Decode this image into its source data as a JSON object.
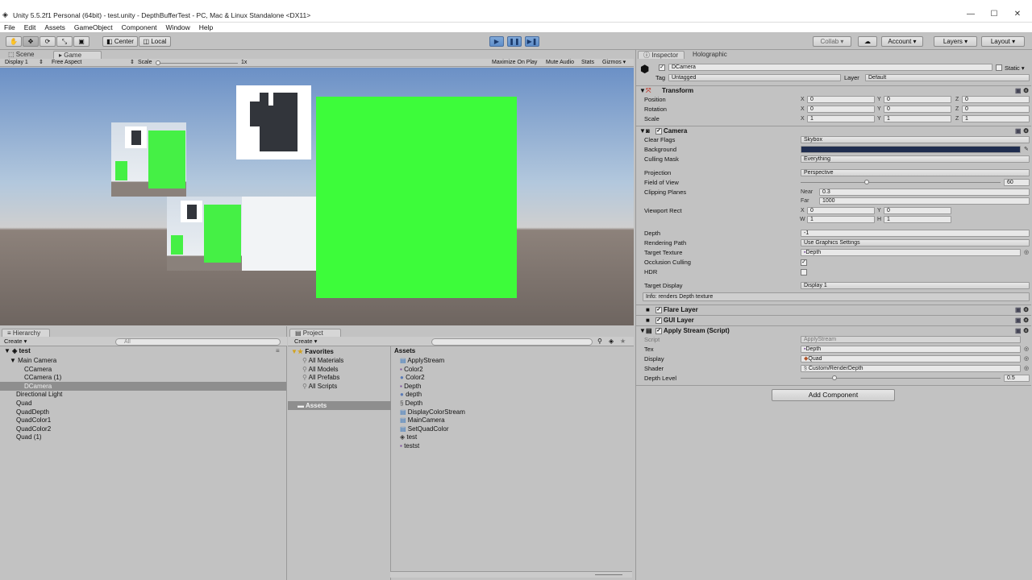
{
  "window": {
    "title": "Unity 5.5.2f1 Personal (64bit) - test.unity - DepthBufferTest - PC, Mac & Linux Standalone <DX11>",
    "controls": [
      "—",
      "☐",
      "✕"
    ]
  },
  "menu": [
    "File",
    "Edit",
    "Assets",
    "GameObject",
    "Component",
    "Window",
    "Help"
  ],
  "toolbar": {
    "pivot_label": "Center",
    "space_label": "Local",
    "collab_label": "Collab ▾",
    "account_label": "Account ▾",
    "layers_label": "Layers ▾",
    "layout_label": "Layout ▾"
  },
  "scene_tabs": [
    "Scene",
    "Game"
  ],
  "gamebar": {
    "display": "Display 1",
    "aspect": "Free Aspect",
    "scale_label": "Scale",
    "scale_value": "1x",
    "maximize": "Maximize On Play",
    "mute": "Mute Audio",
    "stats": "Stats",
    "gizmos": "Gizmos ▾"
  },
  "hierarchy": {
    "tab": "Hierarchy",
    "create": "Create ▾",
    "search_placeholder": "All",
    "scene": "test",
    "items": [
      {
        "label": "Main Camera",
        "indent": 1
      },
      {
        "label": "CCamera",
        "indent": 2
      },
      {
        "label": "CCamera (1)",
        "indent": 2
      },
      {
        "label": "DCamera",
        "indent": 2,
        "selected": true
      },
      {
        "label": "Directional Light",
        "indent": 1
      },
      {
        "label": "Quad",
        "indent": 1
      },
      {
        "label": "QuadDepth",
        "indent": 1
      },
      {
        "label": "QuadColor1",
        "indent": 1
      },
      {
        "label": "QuadColor2",
        "indent": 1
      },
      {
        "label": "Quad (1)",
        "indent": 1
      }
    ]
  },
  "project": {
    "tab": "Project",
    "create": "Create ▾",
    "favorites_label": "Favorites",
    "favorites": [
      "All Materials",
      "All Models",
      "All Prefabs",
      "All Scripts"
    ],
    "assets_folder": "Assets",
    "assets_header": "Assets",
    "assets": [
      {
        "label": "ApplyStream",
        "icon": "script-icon"
      },
      {
        "label": "Color2",
        "icon": "render-texture-icon"
      },
      {
        "label": "Color2",
        "icon": "material-icon"
      },
      {
        "label": "Depth",
        "icon": "render-texture-icon"
      },
      {
        "label": "depth",
        "icon": "material-icon"
      },
      {
        "label": "Depth",
        "icon": "shader-icon"
      },
      {
        "label": "DisplayColorStream",
        "icon": "script-icon"
      },
      {
        "label": "MainCamera",
        "icon": "script-icon"
      },
      {
        "label": "SetQuadColor",
        "icon": "script-icon"
      },
      {
        "label": "test",
        "icon": "scene-icon"
      },
      {
        "label": "testst",
        "icon": "render-texture-icon"
      }
    ]
  },
  "inspector": {
    "tabs": [
      "Inspector",
      "Holographic"
    ],
    "object_name": "DCamera",
    "static_label": "Static ▾",
    "tag_label": "Tag",
    "tag_value": "Untagged",
    "layer_label": "Layer",
    "layer_value": "Default",
    "transform": {
      "title": "Transform",
      "position_label": "Position",
      "rotation_label": "Rotation",
      "scale_label": "Scale",
      "position": [
        "0",
        "0",
        "0"
      ],
      "rotation": [
        "0",
        "0",
        "0"
      ],
      "scale": [
        "1",
        "1",
        "1"
      ]
    },
    "camera": {
      "title": "Camera",
      "clear_flags_label": "Clear Flags",
      "clear_flags": "Skybox",
      "background_label": "Background",
      "background_color": "#1f2d4f",
      "culling_mask_label": "Culling Mask",
      "culling_mask": "Everything",
      "projection_label": "Projection",
      "projection": "Perspective",
      "fov_label": "Field of View",
      "fov": "60",
      "fov_fraction": 0.33,
      "clipping_label": "Clipping Planes",
      "near_label": "Near",
      "near": "0.3",
      "far_label": "Far",
      "far": "1000",
      "viewport_label": "Viewport Rect",
      "viewport": [
        "0",
        "0",
        "1",
        "1"
      ],
      "depth_label": "Depth",
      "depth": "-1",
      "rendering_path_label": "Rendering Path",
      "rendering_path": "Use Graphics Settings",
      "target_texture_label": "Target Texture",
      "target_texture": "Depth",
      "occlusion_label": "Occlusion Culling",
      "hdr_label": "HDR",
      "target_display_label": "Target Display",
      "target_display": "Display 1",
      "info": "Info: renders Depth texture"
    },
    "flare_layer": "Flare Layer",
    "gui_layer": "GUI Layer",
    "apply_stream": {
      "title": "Apply Stream (Script)",
      "script_label": "Script",
      "script": "ApplyStream",
      "tex_label": "Tex",
      "tex": "Depth",
      "display_label": "Display",
      "display": "Quad",
      "shader_label": "Shader",
      "shader": "Custom/RenderDepth",
      "depth_level_label": "Depth Level",
      "depth_level": "0.5",
      "depth_level_fraction": 0.17
    },
    "add_component": "Add Component"
  },
  "colors": {
    "quad_green": "#3dfc3a",
    "selection": "#8e8e8e",
    "panel_bg": "#c2c2c2"
  }
}
